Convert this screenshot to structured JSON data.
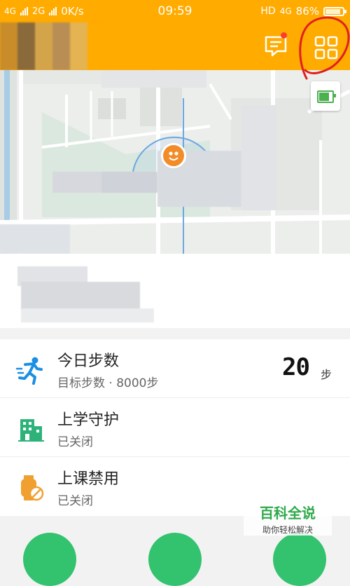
{
  "status_bar": {
    "network_left": "4G",
    "network_2g": "2G",
    "speed": "0K/s",
    "time": "09:59",
    "hd": "HD",
    "network_right": "4G",
    "battery": "86%"
  },
  "header": {
    "message_has_badge": true,
    "accent_color": "#ffab00"
  },
  "map": {
    "battery_status_icon": "battery-full-icon",
    "marker_icon": "child-face-icon"
  },
  "list": {
    "items": [
      {
        "title": "今日步数",
        "subtitle": "目标步数 · 8000步",
        "value": "20",
        "unit": "步",
        "icon": "running-person-icon",
        "icon_color": "#1a8fe3"
      },
      {
        "title": "上学守护",
        "subtitle": "已关闭",
        "icon": "school-building-icon",
        "icon_color": "#2db37a"
      },
      {
        "title": "上课禁用",
        "subtitle": "已关闭",
        "icon": "watch-disabled-icon",
        "icon_color": "#f0a030"
      }
    ]
  },
  "watermark": {
    "title": "百科全说",
    "subtitle": "助你轻松解决"
  }
}
